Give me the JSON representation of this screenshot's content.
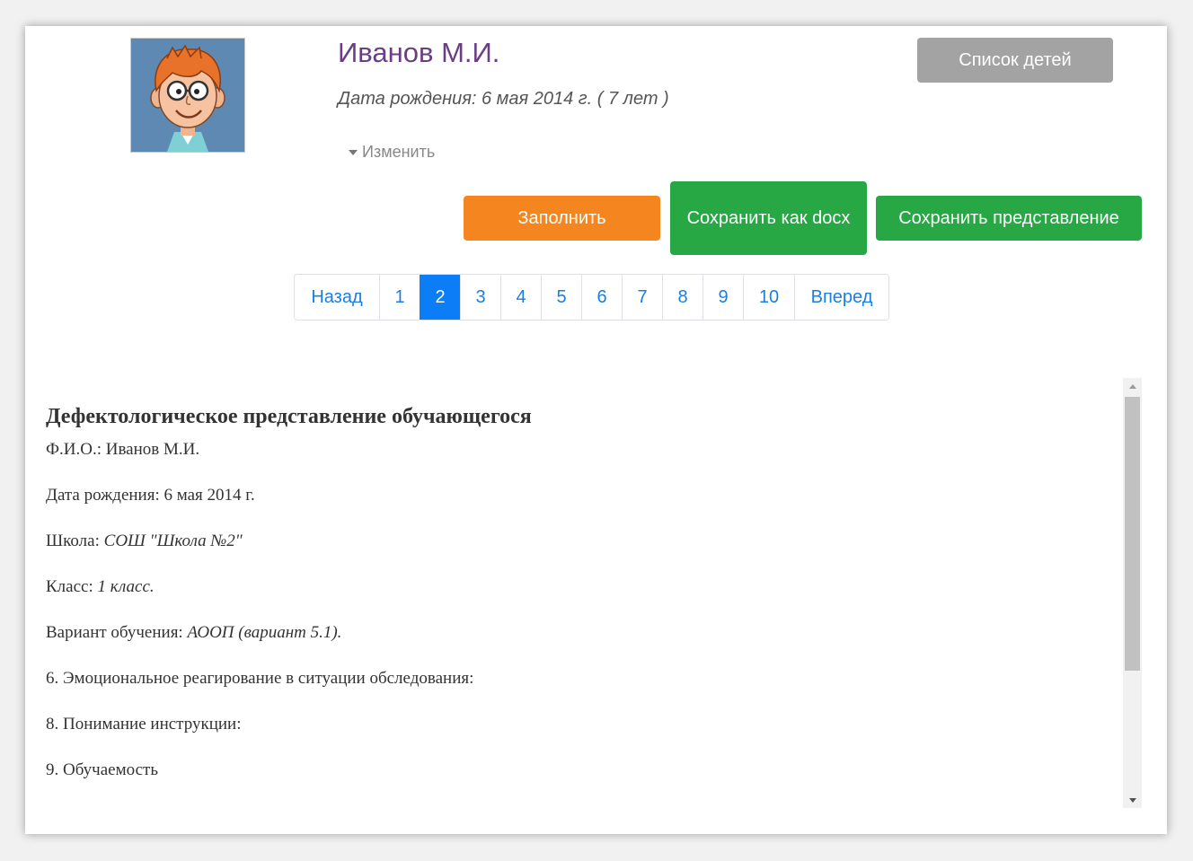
{
  "profile": {
    "name": "Иванов М.И.",
    "birth_info": "Дата рождения: 6 мая 2014 г. ( 7 лет )",
    "edit_label": "Изменить",
    "avatar_icon": "boy-with-glasses-avatar"
  },
  "buttons": {
    "children_list": "Список детей",
    "fill": "Заполнить",
    "save_docx": "Сохранить как docx",
    "save_report": "Сохранить представление"
  },
  "colors": {
    "name": "#6b3e83",
    "fill_button": "#f5861f",
    "save_buttons": "#28a745",
    "children_button": "#a3a3a3",
    "active_page": "#0b7df7",
    "link": "#1a7fe0"
  },
  "pagination": {
    "prev": "Назад",
    "next": "Вперед",
    "pages": [
      "1",
      "2",
      "3",
      "4",
      "5",
      "6",
      "7",
      "8",
      "9",
      "10"
    ],
    "current": "2"
  },
  "document": {
    "title": "Дефектологическое представление обучающегося",
    "fio_label": "Ф.И.О.: Иванов М.И.",
    "birth_label": "Дата рождения: 6 мая 2014 г.",
    "school_label": "Школа: ",
    "school_value": "СОШ \"Школа №2\"",
    "class_label": "Класс: ",
    "class_value": "1 класс.",
    "variant_label": "Вариант обучения: ",
    "variant_value": "АООП (вариант 5.1).",
    "item6": "6. Эмоциональное реагирование в ситуации обследования:",
    "item8": "8. Понимание инструкции:",
    "item9": "9. Обучаемость"
  }
}
